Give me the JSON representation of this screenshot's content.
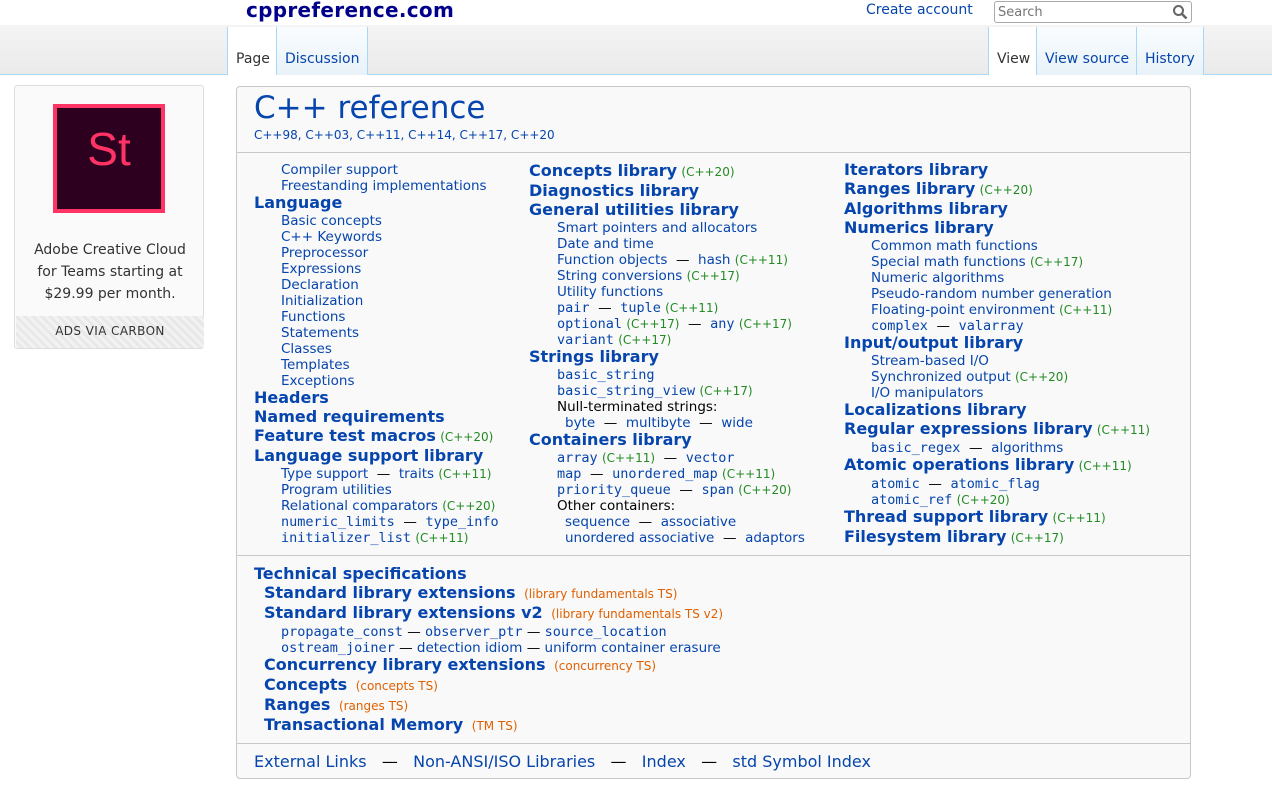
{
  "header": {
    "site_title": "cppreference.com",
    "create_account": "Create account",
    "search_placeholder": "Search",
    "tabs_left": [
      "Page",
      "Discussion"
    ],
    "tabs_right": [
      "View",
      "View source",
      "History"
    ]
  },
  "ad": {
    "logo_text": "St",
    "text_line1": "Adobe Creative Cloud",
    "text_line2": "for Teams starting at",
    "text_line3": "$29.99 per month.",
    "footer": "ADS VIA CARBON"
  },
  "main": {
    "title": "C++ reference",
    "standards": "C++98, C++03, C++11, C++14, C++17, C++20",
    "col1": {
      "compiler_support": "Compiler support",
      "freestanding": "Freestanding implementations",
      "language": "Language",
      "language_items": [
        "Basic concepts",
        "C++ Keywords",
        "Preprocessor",
        "Expressions",
        "Declaration",
        "Initialization",
        "Functions",
        "Statements",
        "Classes",
        "Templates",
        "Exceptions"
      ],
      "headers": "Headers",
      "named_requirements": "Named requirements",
      "feature_test_macros": "Feature test macros",
      "feature_test_ver": "(C++20)",
      "language_support": "Language support library",
      "type_support": "Type support",
      "traits": "traits",
      "traits_ver": "(C++11)",
      "program_utilities": "Program utilities",
      "relational_comparators": "Relational comparators",
      "relational_ver": "(C++20)",
      "numeric_limits": "numeric_limits",
      "type_info": "type_info",
      "initializer_list": "initializer_list",
      "initializer_list_ver": "(C++11)"
    },
    "col2": {
      "concepts": "Concepts library",
      "concepts_ver": "(C++20)",
      "diagnostics": "Diagnostics library",
      "general_utilities": "General utilities library",
      "smart_pointers": "Smart pointers and allocators",
      "date_time": "Date and time",
      "function_objects": "Function objects",
      "hash": "hash",
      "hash_ver": "(C++11)",
      "string_conversions": "String conversions",
      "string_conversions_ver": "(C++17)",
      "utility_functions": "Utility functions",
      "pair": "pair",
      "tuple": "tuple",
      "tuple_ver": "(C++11)",
      "optional": "optional",
      "optional_ver": "(C++17)",
      "any": "any",
      "any_ver": "(C++17)",
      "variant": "variant",
      "variant_ver": "(C++17)",
      "strings": "Strings library",
      "basic_string": "basic_string",
      "basic_string_view": "basic_string_view",
      "basic_string_view_ver": "(C++17)",
      "null_terminated": "Null-terminated strings:",
      "byte": "byte",
      "multibyte": "multibyte",
      "wide": "wide",
      "containers": "Containers library",
      "array": "array",
      "array_ver": "(C++11)",
      "vector": "vector",
      "map": "map",
      "unordered_map": "unordered_map",
      "unordered_map_ver": "(C++11)",
      "priority_queue": "priority_queue",
      "span": "span",
      "span_ver": "(C++20)",
      "other_containers": "Other containers:",
      "sequence": "sequence",
      "associative": "associative",
      "unordered_associative": "unordered associative",
      "adaptors": "adaptors"
    },
    "col3": {
      "iterators": "Iterators library",
      "ranges": "Ranges library",
      "ranges_ver": "(C++20)",
      "algorithms": "Algorithms library",
      "numerics": "Numerics library",
      "common_math": "Common math functions",
      "special_math": "Special math functions",
      "special_math_ver": "(C++17)",
      "numeric_algorithms": "Numeric algorithms",
      "pseudo_random": "Pseudo-random number generation",
      "floating_point": "Floating-point environment",
      "floating_point_ver": "(C++11)",
      "complex": "complex",
      "valarray": "valarray",
      "io": "Input/output library",
      "stream_io": "Stream-based I/O",
      "synchronized_output": "Synchronized output",
      "synchronized_output_ver": "(C++20)",
      "io_manipulators": "I/O manipulators",
      "localizations": "Localizations library",
      "regex": "Regular expressions library",
      "regex_ver": "(C++11)",
      "basic_regex": "basic_regex",
      "regex_algorithms": "algorithms",
      "atomic_ops": "Atomic operations library",
      "atomic_ops_ver": "(C++11)",
      "atomic": "atomic",
      "atomic_flag": "atomic_flag",
      "atomic_ref": "atomic_ref",
      "atomic_ref_ver": "(C++20)",
      "thread_support": "Thread support library",
      "thread_support_ver": "(C++11)",
      "filesystem": "Filesystem library",
      "filesystem_ver": "(C++17)"
    },
    "techspecs": {
      "title": "Technical specifications",
      "std_ext": "Standard library extensions",
      "std_ext_ts": "(library fundamentals TS)",
      "std_ext_v2": "Standard library extensions v2",
      "std_ext_v2_ts": "(library fundamentals TS v2)",
      "propagate_const": "propagate_const",
      "observer_ptr": "observer_ptr",
      "source_location": "source_location",
      "ostream_joiner": "ostream_joiner",
      "detection_idiom": "detection idiom",
      "uniform_container_erasure": "uniform container erasure",
      "concurrency_ext": "Concurrency library extensions",
      "concurrency_ts": "(concurrency TS)",
      "concepts": "Concepts",
      "concepts_ts": "(concepts TS)",
      "ranges": "Ranges",
      "ranges_ts": "(ranges TS)",
      "transactional_memory": "Transactional Memory",
      "tm_ts": "(TM TS)"
    },
    "footer": {
      "external_links": "External Links",
      "non_ansi": "Non-ANSI/ISO Libraries",
      "index": "Index",
      "std_symbol_index": "std Symbol Index"
    }
  },
  "colors": {
    "link": "#0645ad",
    "version": "#228b22",
    "ts": "#e06000",
    "site_title": "#00008b"
  }
}
